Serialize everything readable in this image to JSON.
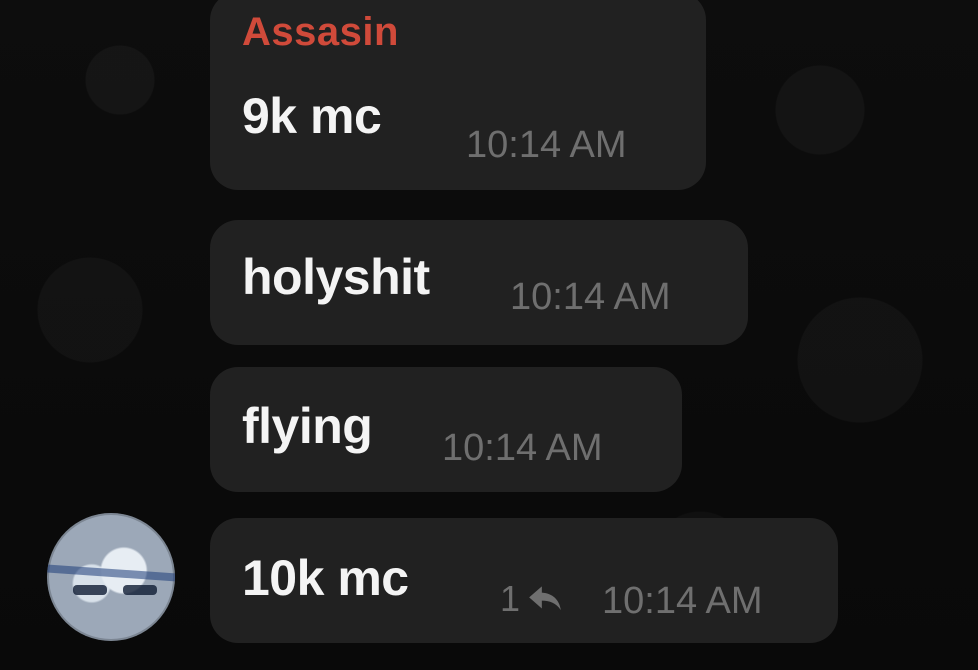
{
  "messages": [
    {
      "sender": "Assasin",
      "text": "9k mc",
      "time": "10:14 AM"
    },
    {
      "text": "holyshit",
      "time": "10:14 AM"
    },
    {
      "text": "flying",
      "time": "10:14 AM"
    },
    {
      "text": "10k mc",
      "time": "10:14 AM",
      "reply_count": "1",
      "reply_icon": "reply-arrow-icon"
    }
  ],
  "colors": {
    "sender": "#d04a3a",
    "bubble": "#212121",
    "timestamp": "#6f6f6f",
    "background": "#0b0b0b"
  }
}
